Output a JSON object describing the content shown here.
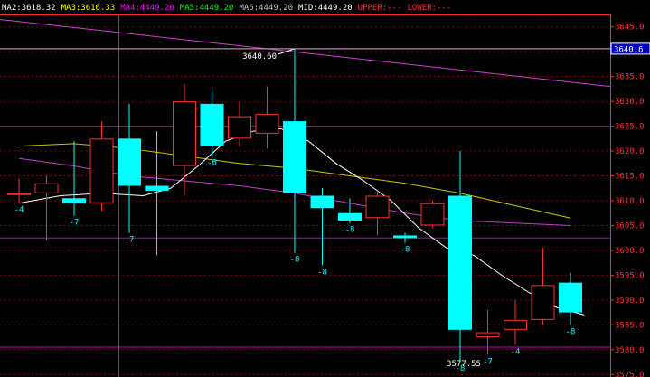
{
  "legend": [
    {
      "key": "ma2",
      "text": "MA2:3618.32",
      "color": "#ffffff"
    },
    {
      "key": "ma3",
      "text": "MA3:3616.33",
      "color": "#ffff00"
    },
    {
      "key": "ma4",
      "text": "MA4:4449.20",
      "color": "#ff00ff"
    },
    {
      "key": "ma5",
      "text": "MA5:4449.20",
      "color": "#00ff00"
    },
    {
      "key": "ma6",
      "text": "MA6:4449.20",
      "color": "#c0c0c0"
    },
    {
      "key": "mid",
      "text": "MID:4449.20",
      "color": "#ffffff"
    },
    {
      "key": "upper",
      "text": "UPPER:---",
      "color": "#ff3030"
    },
    {
      "key": "lower",
      "text": "LOWER:---",
      "color": "#ff3030"
    }
  ],
  "colors": {
    "up": "#ff3030",
    "down": "#00ffff",
    "grid": "#800000",
    "axis": "#ff3030",
    "white_line": "#ffffff",
    "yellow_line": "#c8c800",
    "magenta_line": "#c040c0",
    "trend_line": "#d040d0",
    "crosshair": "#b0b0b0",
    "label": "#00ffff",
    "price_label": "#ffffff",
    "hline": "#c000c0"
  },
  "chart_data": {
    "type": "candlestick",
    "y_ticks": [
      "3645.0",
      "3640.0",
      "3635.0",
      "3630.0",
      "3625.0",
      "3620.0",
      "3615.0",
      "3610.0",
      "3605.0",
      "3600.0",
      "3595.0",
      "3590.0",
      "3585.0",
      "3580.0",
      "3575.0"
    ],
    "y_tick_values": [
      3645,
      3640,
      3635,
      3630,
      3625,
      3620,
      3615,
      3610,
      3605,
      3600,
      3595,
      3590,
      3585,
      3580,
      3575
    ],
    "ylim": [
      3574.5,
      3647.5
    ],
    "current_price_label": "3640.6",
    "current_price": 3640.6,
    "high_annotation": "3640.60",
    "low_annotation": "3577.55",
    "horizontal_levels": [
      3640.6,
      3625.0,
      3602.5,
      3580.5
    ],
    "candles": [
      {
        "open": 3611.5,
        "close": 3611.5,
        "high": 3614.5,
        "low": 3609.5,
        "label": "-4"
      },
      {
        "open": 3611.5,
        "close": 3613.5,
        "high": 3615.0,
        "low": 3602.0,
        "label": ""
      },
      {
        "open": 3610.5,
        "close": 3609.5,
        "high": 3622.0,
        "low": 3607.0,
        "label": "-7"
      },
      {
        "open": 3609.5,
        "close": 3622.5,
        "high": 3626.0,
        "low": 3608.0,
        "label": ""
      },
      {
        "open": 3622.5,
        "close": 3613.0,
        "high": 3629.5,
        "low": 3603.5,
        "label": "-7"
      },
      {
        "open": 3613.0,
        "close": 3612.0,
        "high": 3624.0,
        "low": 3599.0,
        "label": ""
      },
      {
        "open": 3617.0,
        "close": 3630.0,
        "high": 3633.5,
        "low": 3611.0,
        "label": ""
      },
      {
        "open": 3629.5,
        "close": 3621.0,
        "high": 3632.5,
        "low": 3619.0,
        "label": "-6"
      },
      {
        "open": 3622.5,
        "close": 3627.0,
        "high": 3630.0,
        "low": 3621.0,
        "label": ""
      },
      {
        "open": 3623.5,
        "close": 3627.5,
        "high": 3633.0,
        "low": 3620.5,
        "label": ""
      },
      {
        "open": 3626.0,
        "close": 3611.5,
        "high": 3640.6,
        "low": 3599.5,
        "label": "-8"
      },
      {
        "open": 3611.0,
        "close": 3608.5,
        "high": 3612.5,
        "low": 3597.0,
        "label": "-8"
      },
      {
        "open": 3607.5,
        "close": 3606.0,
        "high": 3610.5,
        "low": 3605.5,
        "label": "-8"
      },
      {
        "open": 3606.5,
        "close": 3611.0,
        "high": 3612.0,
        "low": 3603.0,
        "label": ""
      },
      {
        "open": 3603.0,
        "close": 3602.5,
        "high": 3603.5,
        "low": 3601.5,
        "label": "-8"
      },
      {
        "open": 3605.0,
        "close": 3609.5,
        "high": 3610.0,
        "low": 3604.5,
        "label": ""
      },
      {
        "open": 3611.0,
        "close": 3584.0,
        "high": 3620.0,
        "low": 3577.55,
        "label": "-8"
      },
      {
        "open": 3582.5,
        "close": 3583.5,
        "high": 3588.0,
        "low": 3579.0,
        "label": "-7"
      },
      {
        "open": 3584.0,
        "close": 3586.0,
        "high": 3590.0,
        "low": 3581.0,
        "label": "-4"
      },
      {
        "open": 3586.0,
        "close": 3593.0,
        "high": 3600.5,
        "low": 3585.0,
        "label": ""
      },
      {
        "open": 3593.5,
        "close": 3587.5,
        "high": 3595.5,
        "low": 3585.0,
        "label": "-8"
      }
    ],
    "ma_white": {
      "x": [
        0,
        1.5,
        3,
        4.5,
        5.5,
        6.5,
        7.5,
        8.5,
        9.5,
        10.5,
        11.5,
        12.5,
        13.5,
        14.5,
        15.5,
        16.5,
        17.5,
        18.5,
        19.5,
        20.5
      ],
      "y": [
        3609.5,
        3611.0,
        3611.5,
        3611.0,
        3612.5,
        3617.0,
        3622.0,
        3624.0,
        3624.5,
        3622.0,
        3617.5,
        3614.0,
        3610.0,
        3604.5,
        3600.5,
        3599.0,
        3595.0,
        3591.5,
        3588.5,
        3587.0
      ]
    },
    "ma_yellow": {
      "x": [
        0,
        2,
        4,
        6,
        8,
        10,
        12,
        14,
        16,
        18,
        20
      ],
      "y": [
        3621.0,
        3621.5,
        3620.5,
        3619.0,
        3617.5,
        3616.5,
        3615.0,
        3613.5,
        3611.5,
        3609.0,
        3606.5
      ]
    },
    "ma_magenta": {
      "x": [
        0,
        2,
        4,
        6,
        8,
        10,
        12,
        14,
        16,
        18,
        20
      ],
      "y": [
        3618.5,
        3617.0,
        3615.0,
        3614.0,
        3613.0,
        3611.5,
        3609.5,
        3607.5,
        3606.0,
        3605.5,
        3605.0
      ]
    },
    "trend_line": {
      "y_start": 3646.5,
      "y_end": 3633.0
    }
  }
}
